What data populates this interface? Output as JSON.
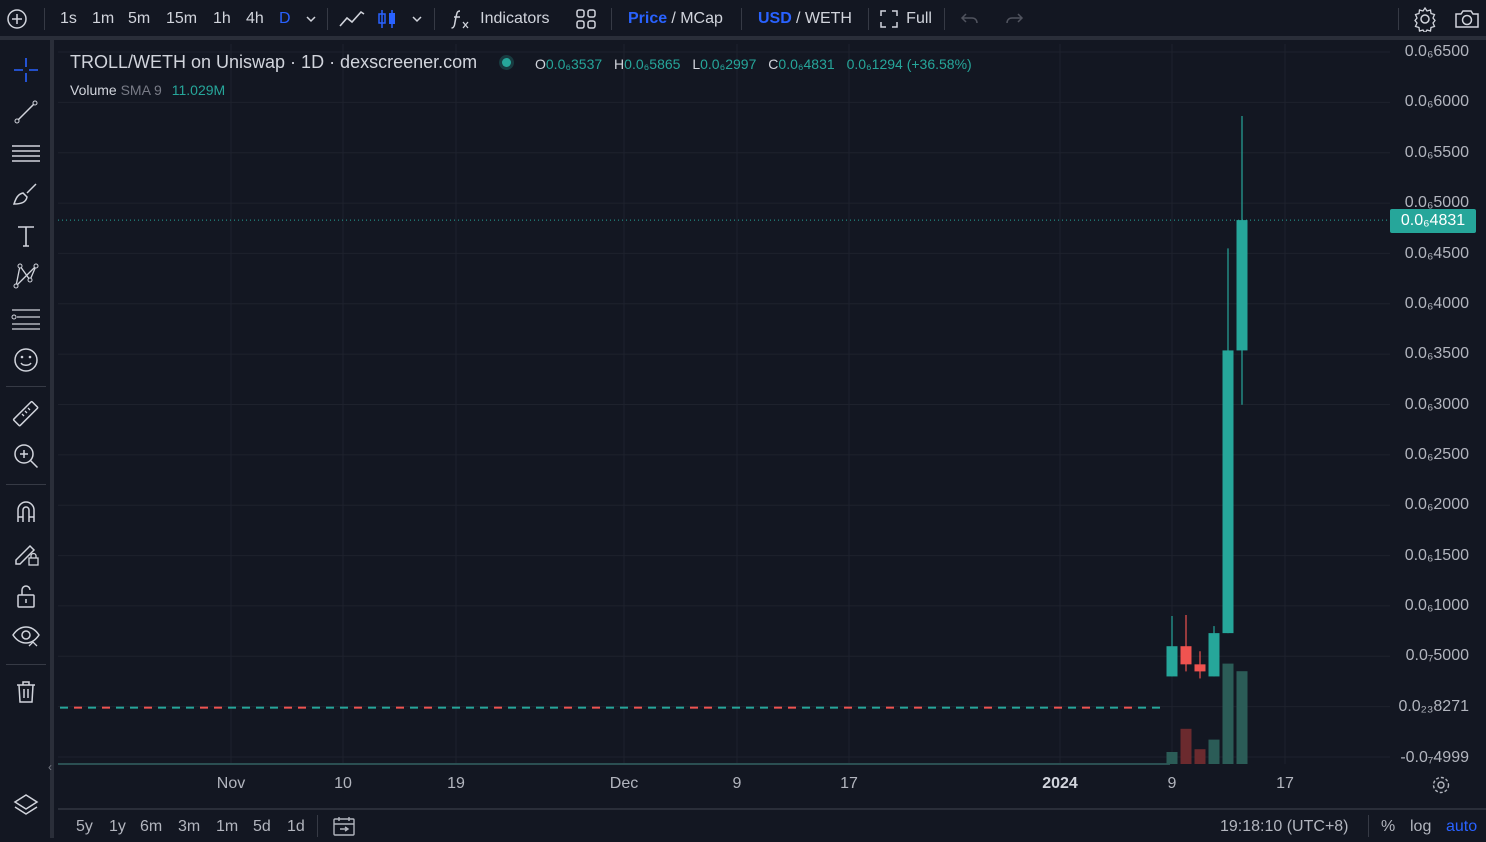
{
  "toolbar": {
    "timeframes": [
      "1s",
      "1m",
      "5m",
      "15m",
      "1h",
      "4h",
      "D"
    ],
    "active_timeframe": "D",
    "indicators_label": "Indicators",
    "price_label": "Price",
    "price_mcap_sep": "/ MCap",
    "usd_label": "USD",
    "weth_label": "/ WETH",
    "full_label": "Full"
  },
  "legend": {
    "title": "TROLL/WETH on Uniswap · 1D · dexscreener.com",
    "o_key": "O",
    "o_val": "0.0₆3537",
    "h_key": "H",
    "h_val": "0.0₆5865",
    "l_key": "L",
    "l_val": "0.0₆2997",
    "c_key": "C",
    "c_val": "0.0₆4831",
    "change": "0.0₆1294 (+36.58%)",
    "volume_label": "Volume",
    "sma_label": "SMA 9",
    "sma_value": "11.029M"
  },
  "price_axis": {
    "labels": [
      "0.0₆6500",
      "0.0₆6000",
      "0.0₆5500",
      "0.0₆5000",
      "0.0₆4500",
      "0.0₆4000",
      "0.0₆3500",
      "0.0₆3000",
      "0.0₆2500",
      "0.0₆2000",
      "0.0₆1500",
      "0.0₆1000",
      "0.0₇5000",
      "0.0₂₃8271",
      "-0.0₇4999"
    ],
    "current_price": "0.0₆4831"
  },
  "time_axis": {
    "labels": [
      "Nov",
      "10",
      "19",
      "Dec",
      "9",
      "17",
      "2024",
      "9",
      "17"
    ]
  },
  "bottom": {
    "ranges": [
      "5y",
      "1y",
      "6m",
      "3m",
      "1m",
      "5d",
      "1d"
    ],
    "clock": "19:18:10 (UTC+8)",
    "pct": "%",
    "log": "log",
    "auto": "auto"
  },
  "colors": {
    "background": "#131722",
    "up": "#26a69a",
    "down": "#ef5350",
    "accent": "#2962ff",
    "text": "#d1d4dc"
  },
  "chart_data": {
    "type": "candlestick",
    "title": "TROLL/WETH on Uniswap · 1D · dexscreener.com",
    "ylabel": "",
    "xlabel": "",
    "ylim": [
      -5e-08,
      6.5e-07
    ],
    "candles": [
      {
        "date": "2024-01-09",
        "open": 3e-08,
        "high": 9e-08,
        "low": 3e-08,
        "close": 6e-08
      },
      {
        "date": "2024-01-10",
        "open": 6e-08,
        "high": 9.1e-08,
        "low": 3.5e-08,
        "close": 4.2e-08
      },
      {
        "date": "2024-01-11",
        "open": 4.2e-08,
        "high": 5.5e-08,
        "low": 2.8e-08,
        "close": 3.5e-08
      },
      {
        "date": "2024-01-12",
        "open": 3e-08,
        "high": 8e-08,
        "low": 3e-08,
        "close": 7.3e-08
      },
      {
        "date": "2024-01-13",
        "open": 7.3e-08,
        "high": 4.55e-07,
        "low": 7.3e-08,
        "close": 3.537e-07
      },
      {
        "date": "2024-01-14",
        "open": 3.537e-07,
        "high": 5.865e-07,
        "low": 2.997e-07,
        "close": 4.831e-07
      }
    ],
    "volume": [
      {
        "date": "2024-01-09",
        "direction": "up",
        "level": 0.3
      },
      {
        "date": "2024-01-10",
        "direction": "down",
        "level": 0.88
      },
      {
        "date": "2024-01-11",
        "direction": "down",
        "level": 0.37
      },
      {
        "date": "2024-01-12",
        "direction": "up",
        "level": 0.61
      },
      {
        "date": "2024-01-13",
        "direction": "up",
        "level": 2.51
      },
      {
        "date": "2024-01-14",
        "direction": "up",
        "level": 2.32
      }
    ],
    "volume_sma9": "11.029M",
    "grid": true
  }
}
